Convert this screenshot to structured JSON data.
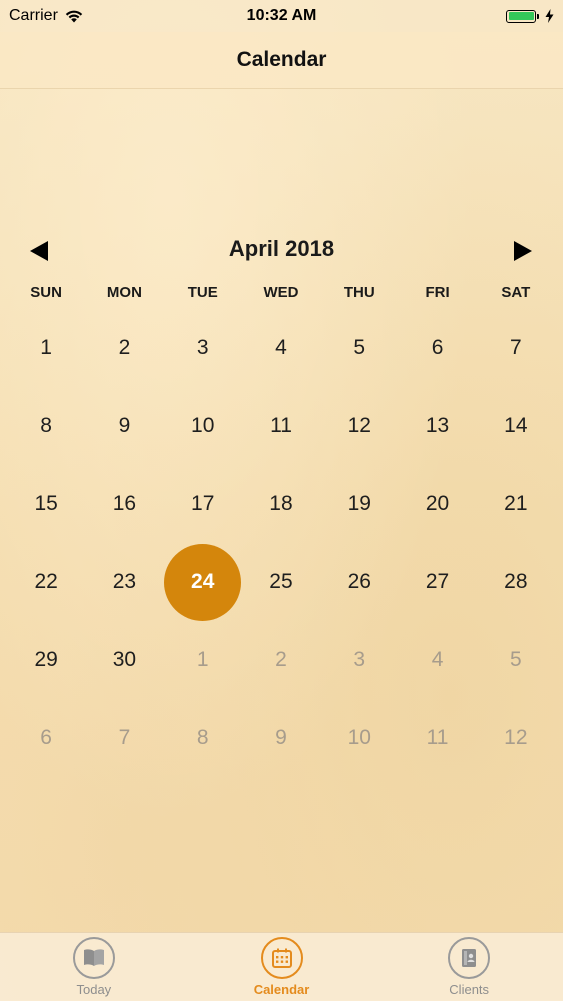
{
  "status_bar": {
    "carrier": "Carrier",
    "time": "10:32 AM",
    "icons": [
      "wifi-icon",
      "battery-icon",
      "charging-bolt-icon"
    ]
  },
  "nav": {
    "title": "Calendar"
  },
  "calendar": {
    "month_label": "April 2018",
    "prev_icon": "triangle-left-icon",
    "next_icon": "triangle-right-icon",
    "weekdays": [
      "SUN",
      "MON",
      "TUE",
      "WED",
      "THU",
      "FRI",
      "SAT"
    ],
    "weeks": [
      [
        "1",
        "2",
        "3",
        "4",
        "5",
        "6",
        "7"
      ],
      [
        "8",
        "9",
        "10",
        "11",
        "12",
        "13",
        "14"
      ],
      [
        "15",
        "16",
        "17",
        "18",
        "19",
        "20",
        "21"
      ],
      [
        "22",
        "23",
        "24",
        "25",
        "26",
        "27",
        "28"
      ],
      [
        "29",
        "30",
        "1",
        "2",
        "3",
        "4",
        "5"
      ],
      [
        "6",
        "7",
        "8",
        "9",
        "10",
        "11",
        "12"
      ]
    ],
    "selected_day": "24",
    "colors": {
      "selected": "#d4860c",
      "other_month_text": "#a79c8c"
    }
  },
  "tab_bar": {
    "tabs": [
      {
        "label": "Today",
        "icon": "book-icon",
        "active": false
      },
      {
        "label": "Calendar",
        "icon": "calendar-icon",
        "active": true
      },
      {
        "label": "Clients",
        "icon": "contacts-icon",
        "active": false
      }
    ],
    "colors": {
      "active": "#e48b1d",
      "inactive": "#8e8e8e"
    }
  }
}
